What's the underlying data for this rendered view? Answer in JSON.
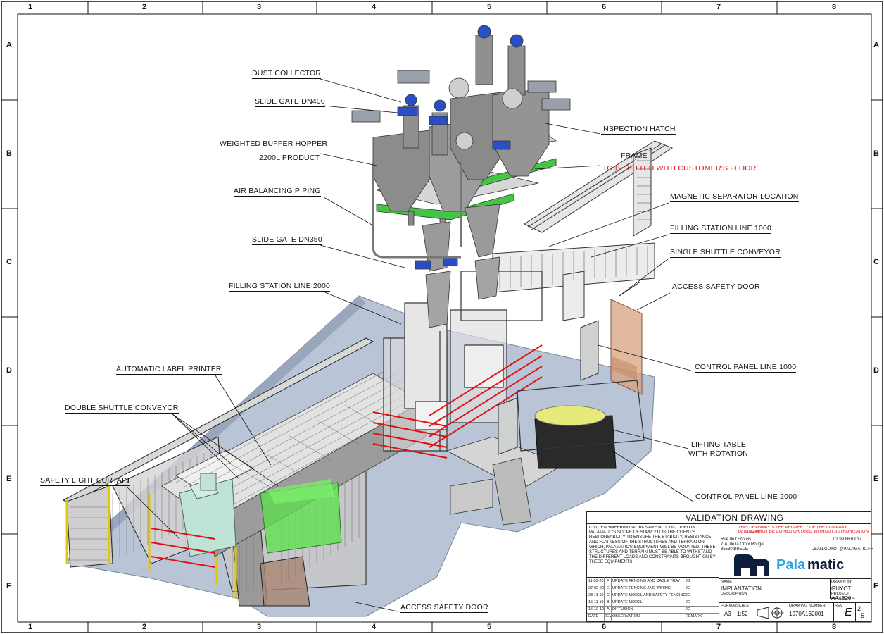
{
  "frame": {
    "columns": [
      "1",
      "2",
      "3",
      "4",
      "5",
      "6",
      "7",
      "8"
    ],
    "rows": [
      "A",
      "B",
      "C",
      "D",
      "E",
      "F"
    ]
  },
  "labels": {
    "dust_collector": "DUST COLLECTOR",
    "slide_gate_dn400": "SLIDE GATE DN400",
    "weighted_buffer_hopper": "WEIGHTED BUFFER HOPPER",
    "hopper_capacity": "2200L PRODUCT",
    "air_balancing_piping": "AIR BALANCING PIPING",
    "slide_gate_dn350": "SLIDE GATE DN350",
    "filling_station_2000": "FILLING STATION LINE 2000",
    "automatic_label_printer": "AUTOMATIC LABEL PRINTER",
    "double_shuttle_conveyor": "DOUBLE SHUTTLE CONVEYOR",
    "safety_light_curtain": "SAFETY  LIGHT CURTAIN",
    "access_safety_door_bottom": "ACCESS SAFETY DOOR",
    "inspection_hatch": "INSPECTION HATCH",
    "frame": "FRAME",
    "frame_note": "TO BE FITTED WITH CUSTOMER'S FLOOR",
    "magnetic_separator": "MAGNETIC SEPARATOR LOCATION",
    "filling_station_1000": "FILLING STATION LINE 1000",
    "single_shuttle_conveyor": "SINGLE SHUTTLE CONVEYOR",
    "access_safety_door_right": "ACCESS SAFETY DOOR",
    "control_panel_1000": "CONTROL PANEL LINE 1000",
    "lifting_table_1": "LIFTING TABLE",
    "lifting_table_2": "WITH ROTATION",
    "control_panel_2000": "CONTROL PANEL LINE 2000"
  },
  "title_block": {
    "heading": "VALIDATION DRAWING",
    "disclaimer": "CIVIL ENGINEERING WORKS ARE NOT INCLUDED IN PALAMATIC'S SCOPE OF SUPPLY.IT IS THE CLIENT'S RESPONSABILITY TO ENSURE THE STABILITY, RESISTANCE AND FLATNESS OF THE STRUCTURES AND TERRAIN ON WHICH, PALAMATIC'S EQUIPMENT WILL BE MOUNTED. THESE STRUCTURES AND TERRAIN MUST BE ABLE TO WITHSTAND THE DIFFERENT LOADS AND CONSTRAINTS BROUGHT ON BY THESE EQUIPMENTS",
    "property_1": "THIS DRAWING IS THE PROPERTY OF THE COMPANY PALAMATIC",
    "property_2": "IT CANNOT BE COPIED OR USED WITHOUT AUTHORIZATION",
    "address_1": "Rue de l'Ecotais",
    "address_2": "Z.A. de la Croix Rouge",
    "address_3": "35530 BRECE",
    "phone": "02 99 86 63 17",
    "email": "JEAN.GUYOT@PALAMATIC.FR",
    "brand_pal": "Pala",
    "brand_matic": "matic",
    "revisions": [
      {
        "date": "11-03-20",
        "rev": "F",
        "obs": "UPDATE FENCING AND CABLE TRAY",
        "by": "JG"
      },
      {
        "date": "27-02-20",
        "rev": "E",
        "obs": "UPDATE FENCING AND WIRING",
        "by": "JG"
      },
      {
        "date": "28-11-19",
        "rev": "C",
        "obs": "UPDATE MODEL AND SAFETY FENCING",
        "by": "JG"
      },
      {
        "date": "15-11-19",
        "rev": "B",
        "obs": "UPDATE MODEL",
        "by": "JG"
      },
      {
        "date": "15-10-19",
        "rev": "A",
        "obs": "DIFFUSION",
        "by": "JG"
      }
    ],
    "rev_header": {
      "date": "DATE",
      "rev": "REV",
      "obs": "OBSERVATION",
      "by": "REMARK"
    },
    "name_label": "NAME",
    "name_value": "IMPLANTATION",
    "description_label": "DESCRIPTION",
    "drawn_by_label": "DRAWN BY",
    "drawn_by_value": "GUYOT",
    "project_ref_label": "PROJECT REFERENCE",
    "project_ref_value": "AA1620",
    "format_label": "FORMAT",
    "format_value": "A3",
    "scale_label": "SCALE",
    "scale_value": "1:52",
    "drawing_number_label": "DRAWING NUMBER",
    "drawing_number_value": "1970A162001",
    "rev_label": "REV",
    "rev_value": "E",
    "sheet_num": "2",
    "sheet_total": "5"
  }
}
